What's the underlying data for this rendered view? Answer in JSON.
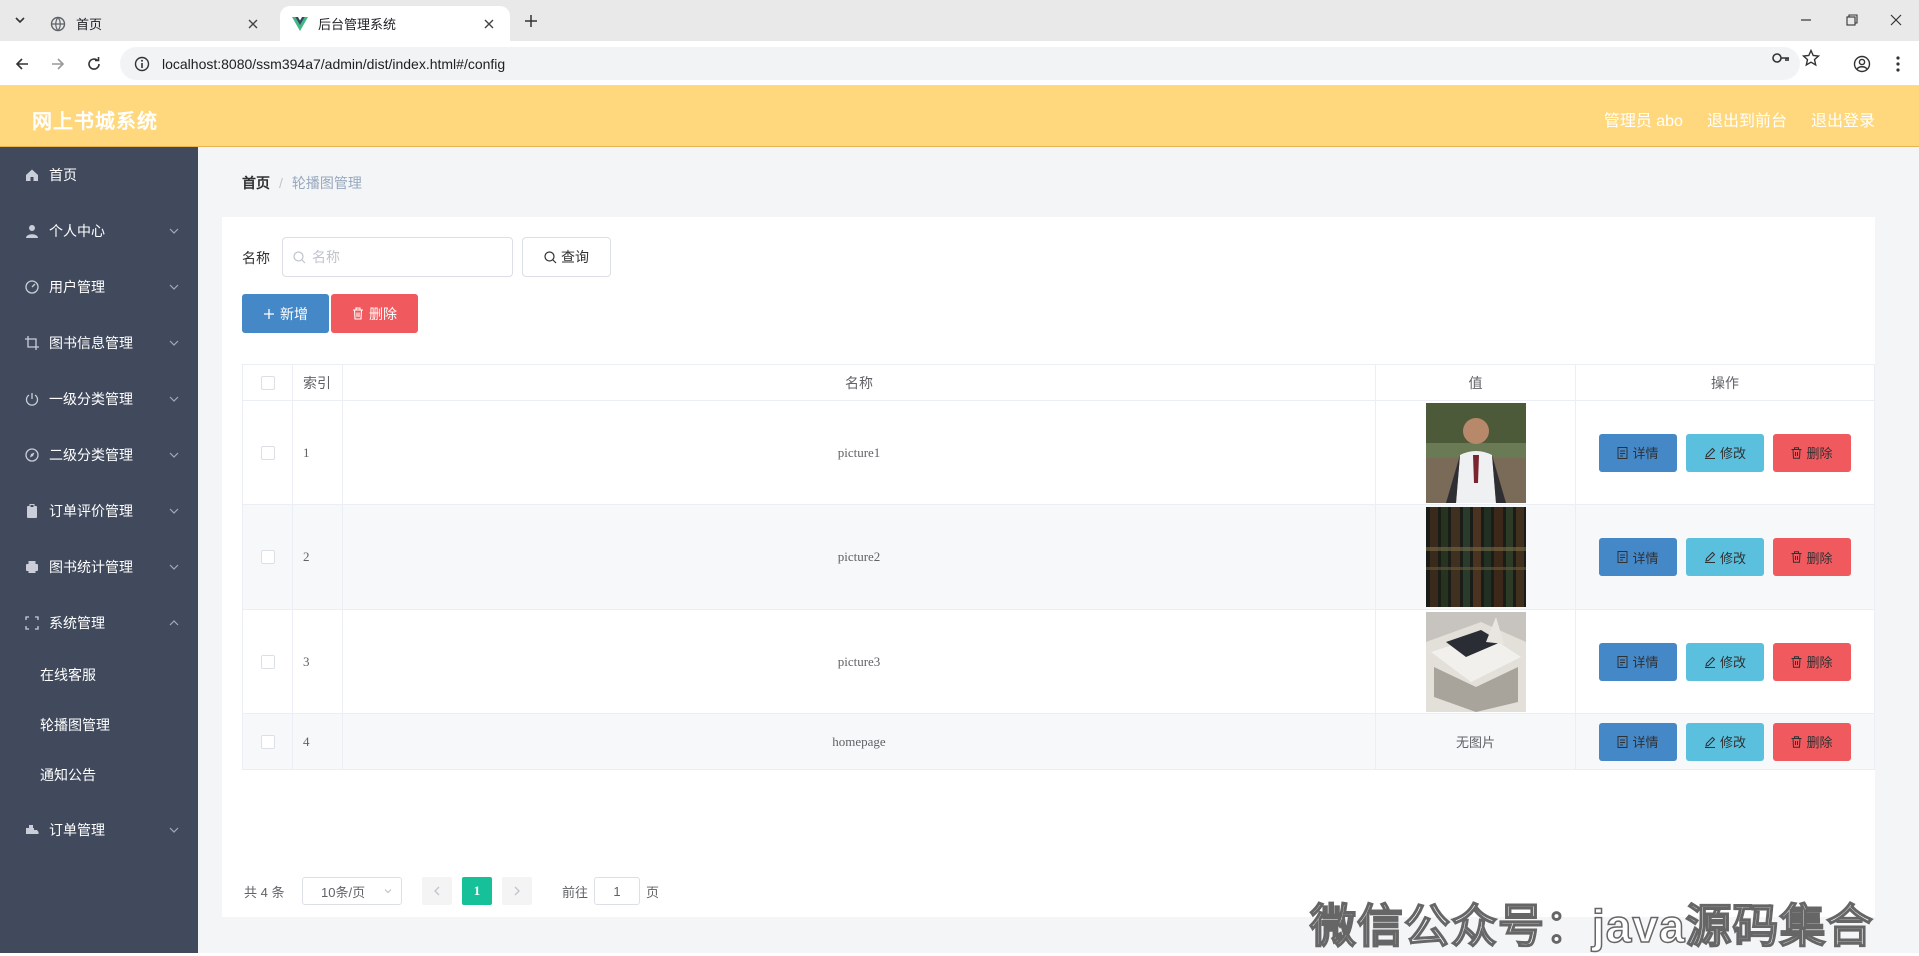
{
  "browser": {
    "tabs": [
      {
        "label": "首页",
        "active": false
      },
      {
        "label": "后台管理系统",
        "active": true
      }
    ],
    "url": "localhost:8080/ssm394a7/admin/dist/index.html#/config"
  },
  "header": {
    "title": "网上书城系统",
    "user_label": "管理员 abo",
    "links": [
      "退出到前台",
      "退出登录"
    ],
    "color": "#ffd87e"
  },
  "sidebar": {
    "items": [
      {
        "label": "首页",
        "icon": "home-icon"
      },
      {
        "label": "个人中心",
        "icon": "user-icon"
      },
      {
        "label": "用户管理",
        "icon": "dashboard-icon"
      },
      {
        "label": "图书信息管理",
        "icon": "crop-icon"
      },
      {
        "label": "一级分类管理",
        "icon": "power-icon"
      },
      {
        "label": "二级分类管理",
        "icon": "compass-icon"
      },
      {
        "label": "订单评价管理",
        "icon": "clipboard-icon"
      },
      {
        "label": "图书统计管理",
        "icon": "printer-icon"
      },
      {
        "label": "系统管理",
        "icon": "fullscreen-icon"
      },
      {
        "label": "订单管理",
        "icon": "truck-icon"
      }
    ],
    "subitems": [
      "在线客服",
      "轮播图管理",
      "通知公告"
    ],
    "color": "#414a5c"
  },
  "breadcrumb": {
    "home": "首页",
    "separator": "/",
    "current": "轮播图管理"
  },
  "search": {
    "label": "名称",
    "placeholder": "名称",
    "button": "查询"
  },
  "actions": {
    "add": "新增",
    "delete": "删除"
  },
  "table": {
    "headers": [
      "索引",
      "名称",
      "值",
      "操作"
    ],
    "rows": [
      {
        "index": "1",
        "name": "picture1",
        "value": "image"
      },
      {
        "index": "2",
        "name": "picture2",
        "value": "image"
      },
      {
        "index": "3",
        "name": "picture3",
        "value": "image"
      },
      {
        "index": "4",
        "name": "homepage",
        "value": "无图片"
      }
    ],
    "ops": {
      "detail": "详情",
      "edit": "修改",
      "delete": "删除"
    }
  },
  "pagination": {
    "total": "共 4 条",
    "page_size": "10条/页",
    "current_page": "1",
    "goto_prefix": "前往",
    "goto_value": "1",
    "goto_suffix": "页"
  },
  "watermark": "微信公众号：java源码集合"
}
